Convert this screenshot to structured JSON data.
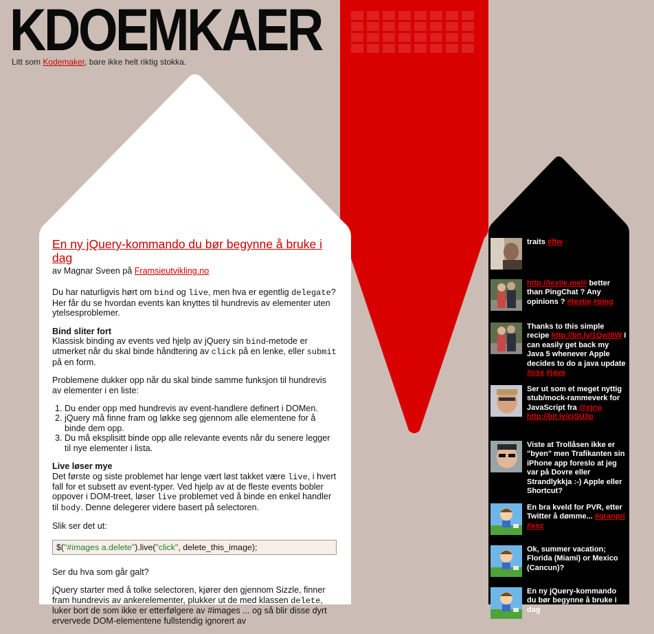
{
  "header": {
    "title": "KDOEMKAER",
    "tagline_prefix": "Litt som ",
    "tagline_link": "Kodemaker",
    "tagline_suffix": ", bare ikke helt riktig stokka."
  },
  "post": {
    "title": "En ny jQuery-kommando du bør begynne å bruke i dag",
    "byline_prefix": "av Magnar Sveen på ",
    "byline_link": "Framsieutvikling.no",
    "intro": {
      "t1": "Du har naturligvis hørt om ",
      "c1": "bind",
      "t2": " og ",
      "c2": "live",
      "t3": ", men hva er egentlig ",
      "c3": "delegate",
      "t4": "? Her får du se hvordan events kan knyttes til hundrevis av elementer uten ytelsesproblemer."
    },
    "section1_heading": "Bind sliter fort",
    "section1": {
      "t1": "Klassisk binding av events ved hjelp av jQuery sin ",
      "c1": "bind",
      "t2": "-metode er utmerket når du skal binde håndtering av ",
      "c2": "click",
      "t3": " på en lenke, eller ",
      "c3": "submit",
      "t4": " på en form."
    },
    "problem_intro": "Problemene dukker opp når du skal binde samme funksjon til hundrevis av elementer i en liste:",
    "problem_list": [
      "Du ender opp med hundrevis av event-handlere definert i DOMen.",
      "jQuery må finne fram og løkke seg gjennom alle elementene for å binde dem opp.",
      "Du må eksplisitt binde opp alle relevante events når du senere legger til nye elementer i lista."
    ],
    "section2_heading": "Live løser mye",
    "section2": {
      "t1": "Det første og siste problemet har lenge vært løst takket være ",
      "c1": "live",
      "t2": ", i hvert fall for et subsett av event-typer. Ved hjelp av at de fleste events bobler oppover i DOM-treet, løser ",
      "c2": "live",
      "t3": " problemet ved å binde en enkel handler til ",
      "c3": "body",
      "t4": ". Denne delegerer videre basert på selectoren."
    },
    "code_intro": "Slik ser det ut:",
    "code": {
      "p1": "$(",
      "s1": "\"#images a.delete\"",
      "p2": ").live(",
      "s2": "\"click\"",
      "p3": ", delete_this_image);"
    },
    "question": "Ser du hva som går galt?",
    "last_para": {
      "t1": "jQuery starter med å tolke selectoren, kjører den gjennom Sizzle, finner fram hundrevis av ankerelementer, plukker ut de med klassen ",
      "c1": "delete",
      "t2": ", luker bort de som ikke er etterfølgere av #images ... og så blir disse dyrt ervervede DOM-elementene fullstendig ignorert av"
    }
  },
  "tweets": [
    {
      "avatar": "portrait-avatar",
      "parts": [
        {
          "t": "traits "
        },
        {
          "a": "#ftw"
        }
      ]
    },
    {
      "avatar": "couple-avatar",
      "parts": [
        {
          "a": "http://textie.me/#"
        },
        {
          "t": " better than PingChat ? Any opinions ? "
        },
        {
          "a": "#textie"
        },
        {
          "t": " "
        },
        {
          "a": "#ping"
        }
      ]
    },
    {
      "avatar": "couple-avatar",
      "parts": [
        {
          "t": "Thanks to this simple recipe "
        },
        {
          "a": "http://bit.ly/1Qwt8W"
        },
        {
          "t": " I can easily get back my Java 5 whenever Apple decides to do a java update "
        },
        {
          "a": "#osx"
        },
        {
          "t": " "
        },
        {
          "a": "#java"
        }
      ]
    },
    {
      "avatar": "face-avatar",
      "parts": [
        {
          "t": "Ser ut som et meget nyttig stub/mock-rammeverk for JavaScript fra "
        },
        {
          "a": "@cjno"
        },
        {
          "t": " "
        },
        {
          "a": "http://bit.ly/cjSU3p"
        }
      ]
    },
    {
      "avatar": "sunglasses-avatar",
      "parts": [
        {
          "t": "Viste at Trollåsen ikke er \"byen\" men Trafikanten sin iPhone app foreslo at jeg var på Dovre eller Strandlykkja :-) Apple eller Shortcut?"
        }
      ]
    },
    {
      "avatar": "cartoon-avatar",
      "parts": [
        {
          "t": "En bra kveld for PVR, etter Twitter å dømme... "
        },
        {
          "a": "#granpri"
        },
        {
          "t": " "
        },
        {
          "a": "#esc"
        }
      ]
    },
    {
      "avatar": "cartoon-avatar",
      "parts": [
        {
          "t": "Ok, summer vacation; Florida (Miami) or Mexico (Cancun)?"
        }
      ]
    },
    {
      "avatar": "cartoon-avatar",
      "parts": [
        {
          "t": "En ny jQuery-kommando du bør begynne å bruke i dag"
        }
      ]
    }
  ],
  "colors": {
    "accent": "#cc0000",
    "background": "#cbbdb5",
    "banner": "#d90000",
    "twitter_bg": "#000000"
  }
}
